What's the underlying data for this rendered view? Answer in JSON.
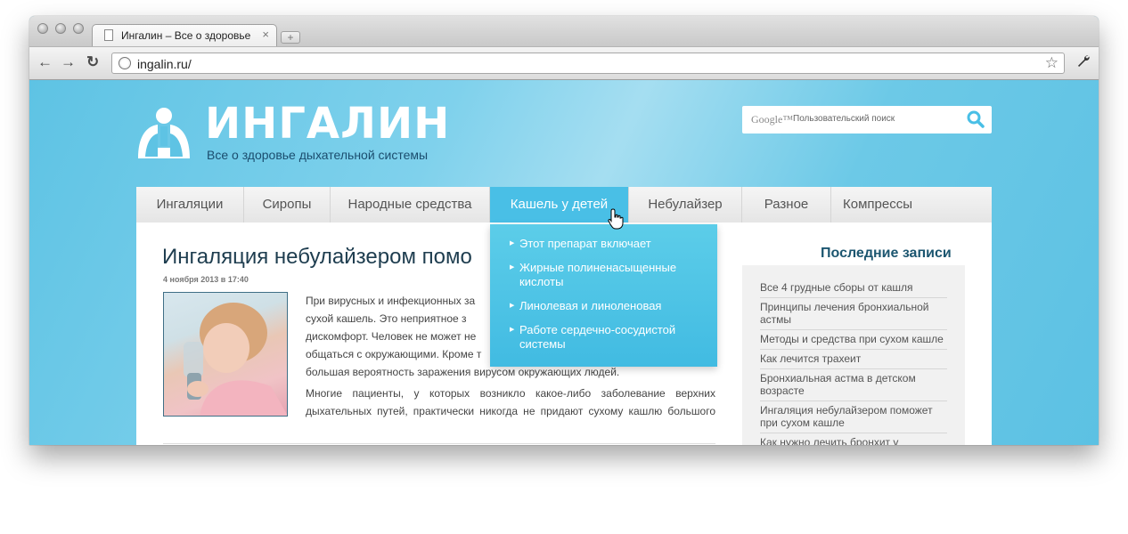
{
  "browser": {
    "tab_title": "Ингалин – Все о здоровье д",
    "url": "ingalin.ru/",
    "new_tab_label": "+",
    "tab_close": "×"
  },
  "site": {
    "logo_text": "ИНГАЛИН",
    "tagline": "Все о здоровье дыхательной системы",
    "search": {
      "brand": "Google™",
      "placeholder": "Пользовательский поиск"
    },
    "nav": [
      "Ингаляции",
      "Сиропы",
      "Народные средства",
      "Кашель у детей",
      "Небулайзер",
      "Разное",
      "Компрессы"
    ],
    "dropdown": [
      "Этот препарат включает",
      "Жирные полиненасыщенные кислоты",
      "Линолевая и линоленовая",
      "Работе сердечно-сосудистой системы"
    ]
  },
  "post": {
    "title": "Ингаляция небулайзером помо",
    "date": "4 ноября 2013 в 17:40",
    "paragraph1_lines": [
      "При вирусных и инфекционных за",
      "сухой кашель. Это неприятное з",
      "дискомфорт. Человек не может не",
      "общаться с окружающими. Кроме т",
      "большая вероятность заражения вирусом окружающих людей."
    ],
    "paragraph2_lines": [
      "Многие пациенты, у которых возникло какое-либо заболевание верхних",
      "дыхательных путей, практически никогда не придают сухому кашлю большого"
    ]
  },
  "sidebar": {
    "title": "Последние записи",
    "items": [
      "Все 4 грудные сборы от кашля",
      "Принципы лечения бронхиальной астмы",
      "Методы и средства при сухом кашле",
      "Как лечится трахеит",
      "Бронхиальная астма в детском возрасте",
      "Ингаляция небулайзером поможет при сухом кашле",
      "Как нужно лечить бронхит у"
    ]
  },
  "colors": {
    "page_bg": "#6cc8e6",
    "nav_active": "#49bfe6",
    "title_color": "#1e3d4f",
    "sidebar_title": "#1c5670"
  }
}
